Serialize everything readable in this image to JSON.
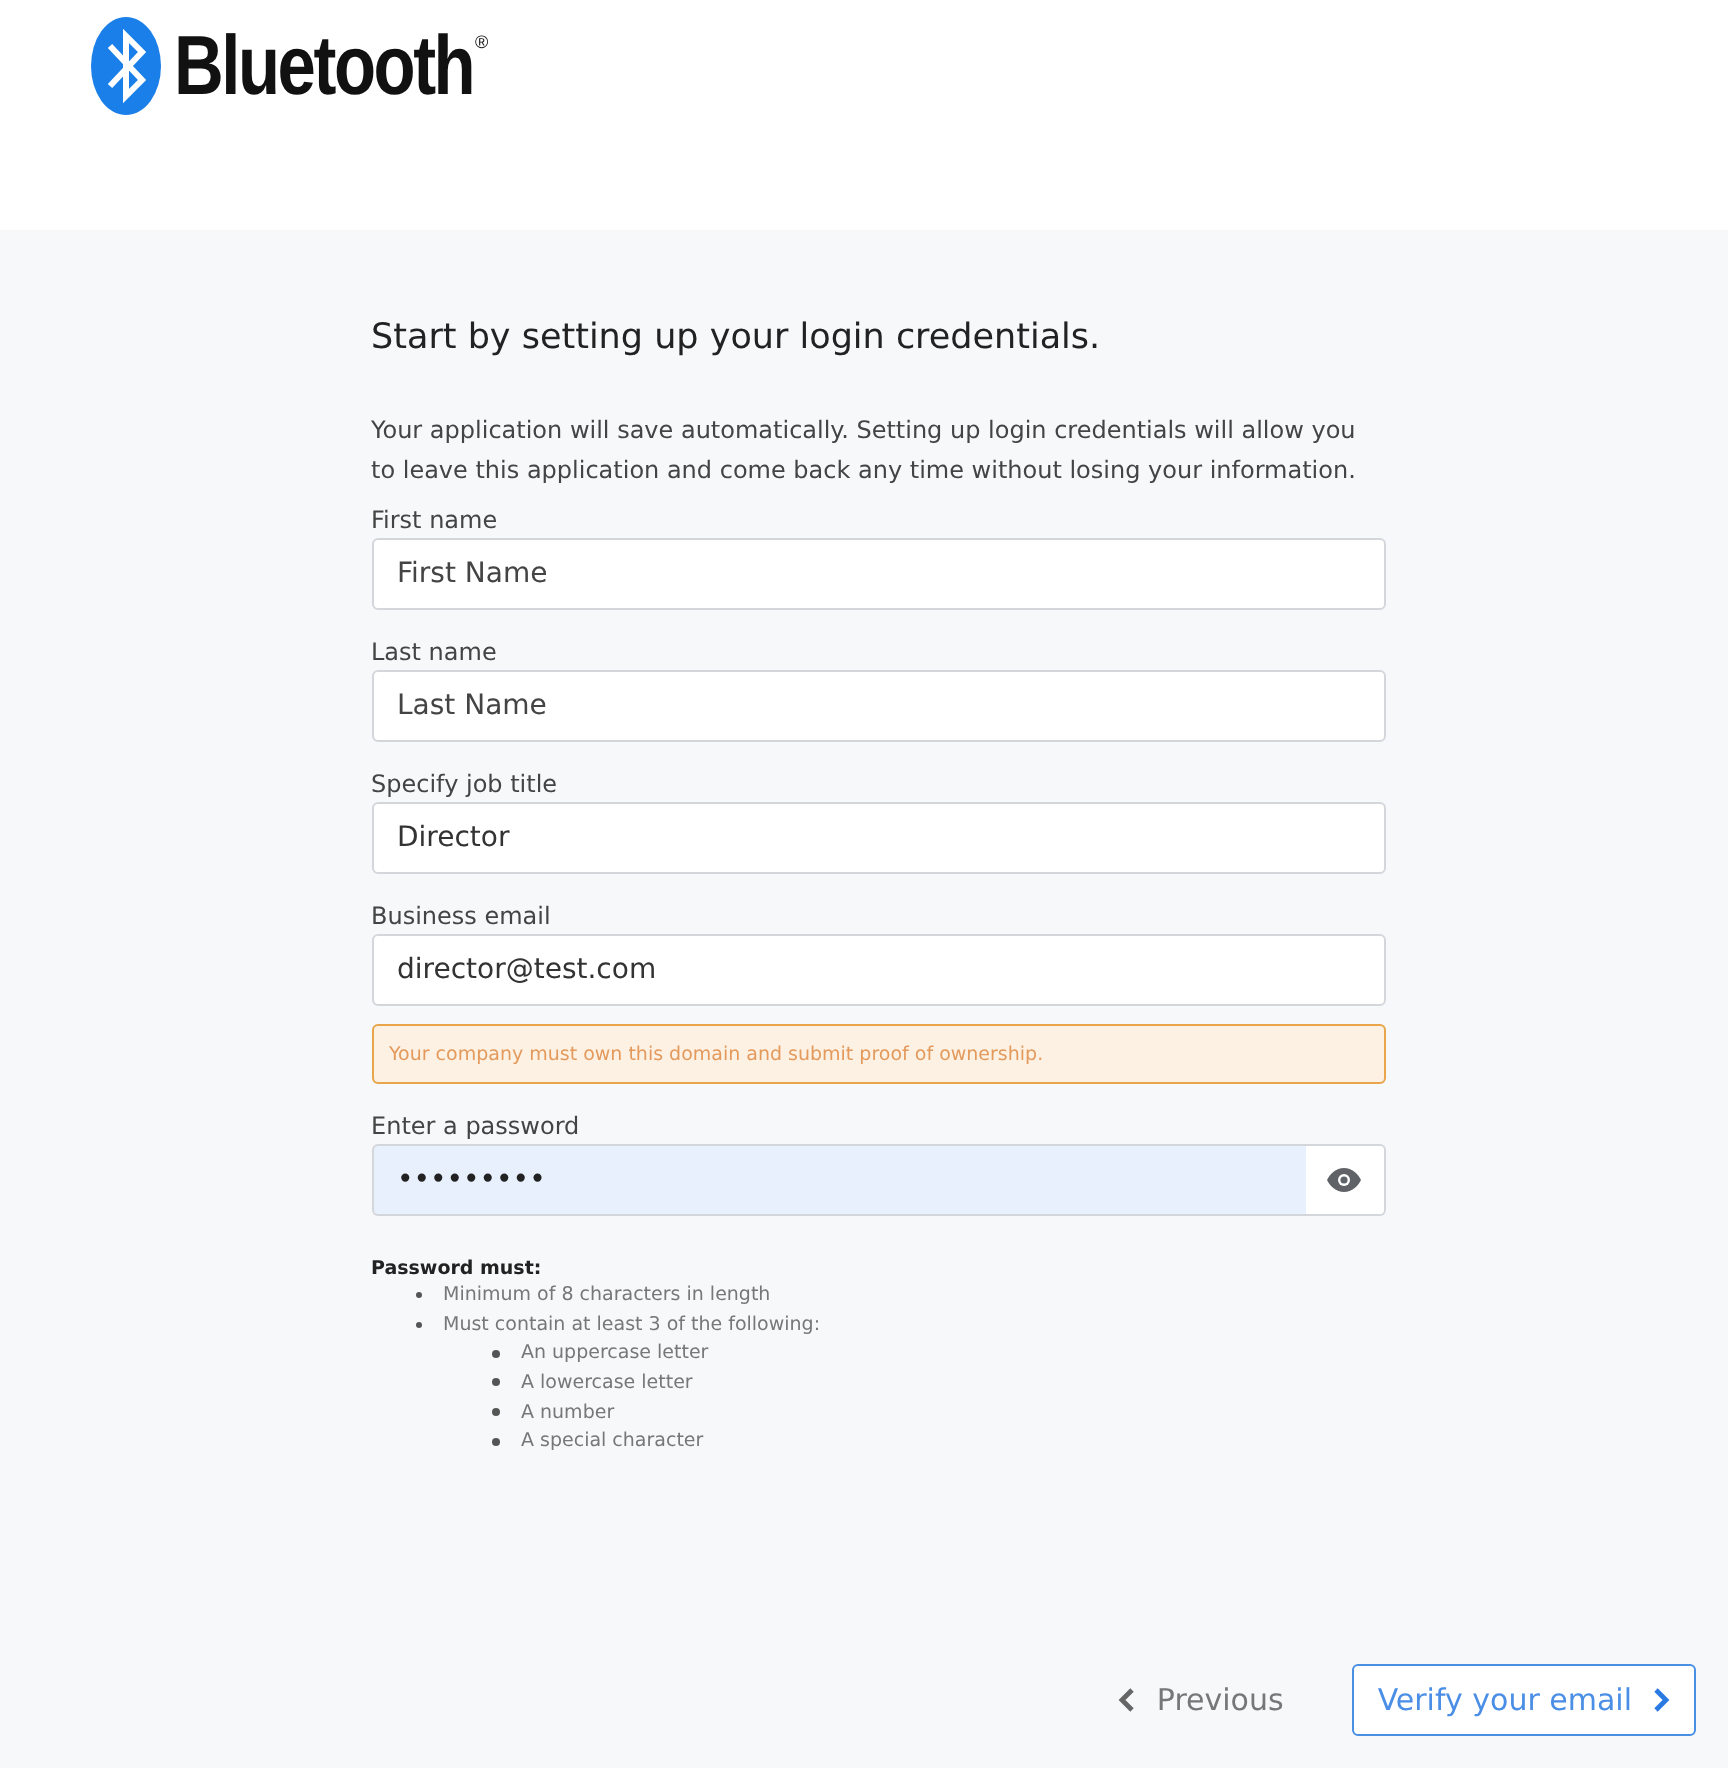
{
  "logo": {
    "wordmark": "Bluetooth",
    "mark": "®"
  },
  "form": {
    "heading": "Start by setting up your login credentials.",
    "intro": "Your application will save automatically. Setting up login credentials will allow you to leave this application and come back any time without losing your information.",
    "fields": [
      {
        "label": "First name",
        "placeholder": "First Name"
      },
      {
        "label": "Last name",
        "placeholder": "Last Name"
      },
      {
        "label": "Specify job title",
        "value": "Director"
      },
      {
        "label": "Business email",
        "value": "director@test.com",
        "warning": "Your company must own this domain and submit proof of ownership."
      },
      {
        "label": "Enter a password",
        "value": "•••••••••",
        "kind": "password"
      }
    ],
    "rules_title": "Password must:",
    "rules": [
      {
        "text": "Minimum of 8 characters in length"
      },
      {
        "text": "Must contain at least 3 of the following:",
        "children": [
          {
            "text": "An uppercase letter"
          },
          {
            "text": "A lowercase letter"
          },
          {
            "text": "A number"
          },
          {
            "text": "A special character"
          }
        ]
      }
    ]
  },
  "nav": {
    "previous": "Previous",
    "next": "Verify your email"
  }
}
